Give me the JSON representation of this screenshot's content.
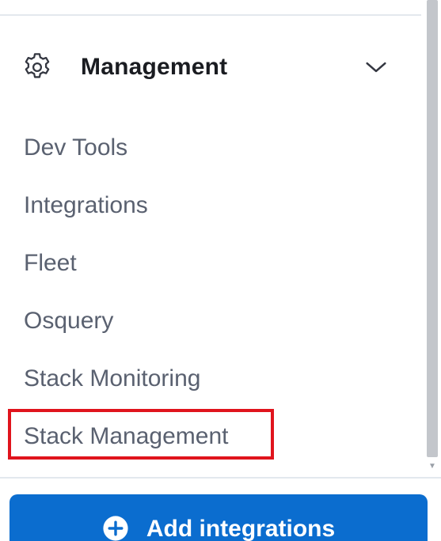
{
  "section": {
    "title": "Management",
    "icon": "gear-icon",
    "expanded": true
  },
  "nav": {
    "items": [
      {
        "label": "Dev Tools"
      },
      {
        "label": "Integrations"
      },
      {
        "label": "Fleet"
      },
      {
        "label": "Osquery"
      },
      {
        "label": "Stack Monitoring"
      },
      {
        "label": "Stack Management"
      }
    ],
    "highlighted": "Stack Management"
  },
  "footer": {
    "add_button_label": "Add integrations",
    "add_button_icon": "plus-circle-icon"
  },
  "colors": {
    "accent": "#0b6dcf",
    "highlight": "#e0141d",
    "text_primary": "#1a1c21",
    "text_secondary": "#5a6170"
  }
}
